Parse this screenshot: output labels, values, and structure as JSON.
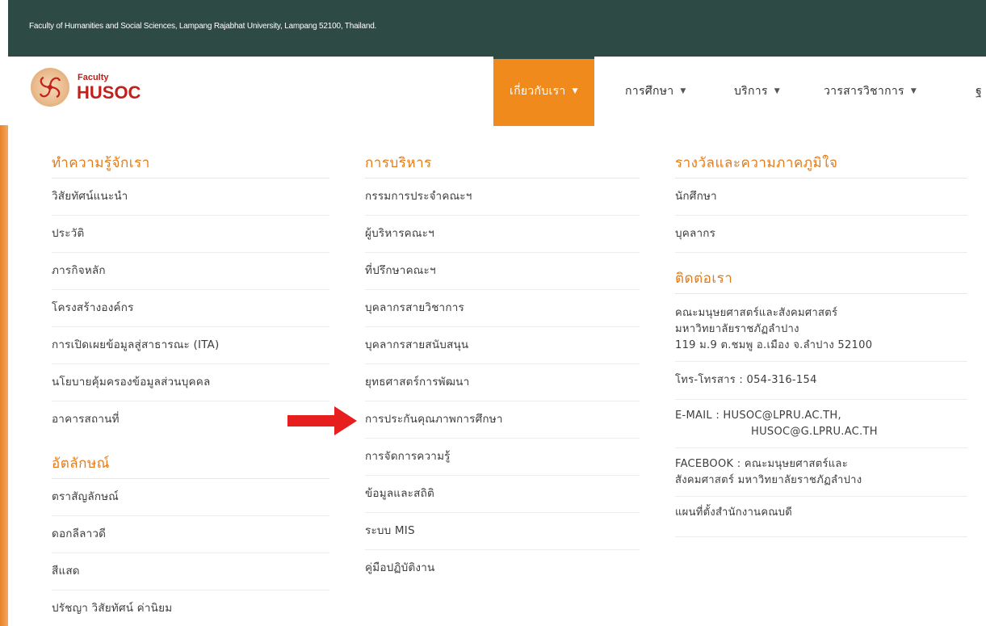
{
  "topbar": {
    "address": "Faculty of Humanities and Social Sciences, Lampang Rajabhat University, Lampang 52100, Thailand."
  },
  "logo": {
    "small": "Faculty",
    "big": "HUSOC"
  },
  "nav": {
    "items": [
      {
        "label": "เกี่ยวกับเรา"
      },
      {
        "label": "การศึกษา"
      },
      {
        "label": "บริการ"
      },
      {
        "label": "วารสารวิชาการ"
      },
      {
        "label": "ฐ"
      }
    ]
  },
  "mega": {
    "col1": {
      "heading": "ทำความรู้จักเรา",
      "items": [
        "วิสัยทัศน์แนะนำ",
        "ประวัติ",
        "ภารกิจหลัก",
        "โครงสร้างองค์กร",
        "การเปิดเผยข้อมูลสู่สาธารณะ (ITA)",
        "นโยบายคุ้มครองข้อมูลส่วนบุคคล",
        "อาคารสถานที่"
      ],
      "heading2": "อัตลักษณ์",
      "items2": [
        "ตราสัญลักษณ์",
        "ดอกลีลาวดี",
        "สีแสด",
        "ปรัชญา วิสัยทัศน์ ค่านิยม"
      ]
    },
    "col2": {
      "heading": "การบริหาร",
      "items": [
        "กรรมการประจำคณะฯ",
        "ผู้บริหารคณะฯ",
        "ที่ปรึกษาคณะฯ",
        "บุคลากรสายวิชาการ",
        "บุคลากรสายสนับสนุน",
        "ยุทธศาสตร์การพัฒนา",
        "การประกันคุณภาพการศึกษา",
        "การจัดการความรู้",
        "ข้อมูลและสถิติ",
        "ระบบ MIS",
        "คู่มือปฏิบัติงาน"
      ]
    },
    "col3": {
      "heading": "รางวัลและความภาคภูมิใจ",
      "items": [
        "นักศึกษา",
        "บุคลากร"
      ],
      "heading2": "ติดต่อเรา",
      "address1": "คณะมนุษยศาสตร์และสังคมศาสตร์",
      "address2": "มหาวิทยาลัยราชภัฏลำปาง",
      "address3": "119 ม.9 ต.ชมพู อ.เมือง จ.ลำปาง 52100",
      "phone": "โทร-โทรสาร : 054-316-154",
      "email1": "E-MAIL : HUSOC@LPRU.AC.TH,",
      "email2": "HUSOC@G.LPRU.AC.TH",
      "facebook1": "FACEBOOK : คณะมนุษยศาสตร์และ",
      "facebook2": "สังคมศาสตร์ มหาวิทยาลัยราชภัฏลำปาง",
      "map": "แผนที่ตั้งสำนักงานคณบดี"
    }
  },
  "colors": {
    "topbar": "#2e4a44",
    "accent": "#f08a1c",
    "heading": "#e27b1a",
    "arrow": "#e61e1e",
    "brand_red": "#c0211b"
  }
}
